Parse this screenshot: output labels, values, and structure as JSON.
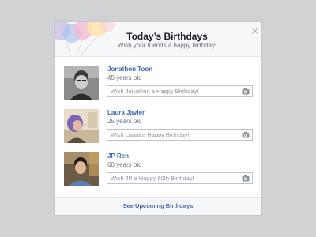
{
  "dialog": {
    "title": "Today’s Birthdays",
    "subtitle": "Wish your friends a happy birthday!",
    "close_icon": "close-icon",
    "decoration_icon": "balloons-icon"
  },
  "friends": [
    {
      "name": "Jonathon Toon",
      "age": "45 years old",
      "placeholder": "Wish Jonathon a Happy Birthday!",
      "photo_icon": "camera-icon"
    },
    {
      "name": "Laura Javier",
      "age": "25 years old",
      "placeholder": "Wish Laura a Happy Birthday!",
      "photo_icon": "camera-icon"
    },
    {
      "name": "JP Ren",
      "age": "60 years old",
      "placeholder": "Wish JP a Happy 60th Birthday!",
      "photo_icon": "camera-icon"
    }
  ],
  "footer": {
    "link_label": "See Upcoming Birthdays"
  },
  "colors": {
    "link": "#4267b2",
    "header_bg": "#f6f7f9",
    "page_bg": "#d1d2d4"
  }
}
